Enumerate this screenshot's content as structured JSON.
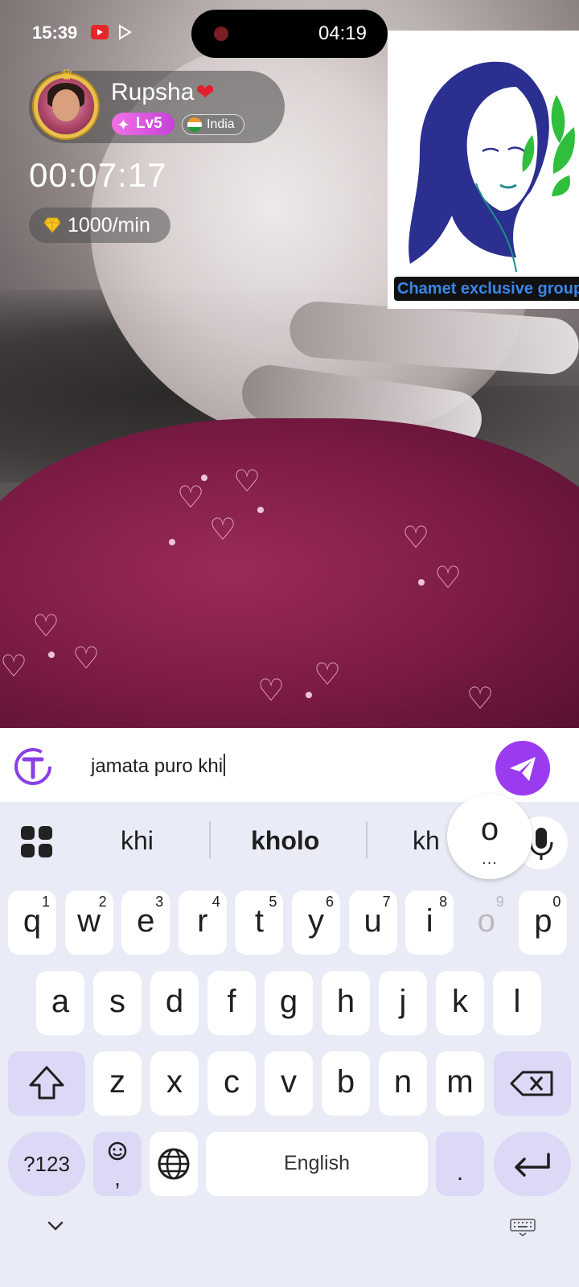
{
  "status_bar": {
    "time": "15:39",
    "recording_time": "04:19"
  },
  "host": {
    "name": "Rupsha",
    "level": "Lv5",
    "country": "India"
  },
  "call": {
    "timer": "00:07:17",
    "rate": "1000/min"
  },
  "promo": {
    "caption": "Chamet exclusive group"
  },
  "composer": {
    "text": "jamata puro khi"
  },
  "keyboard": {
    "suggestions": [
      "khi",
      "kholo",
      "kh"
    ],
    "popup_char": "o",
    "popup_dots": "...",
    "row1": [
      {
        "ch": "q",
        "hint": "1"
      },
      {
        "ch": "w",
        "hint": "2"
      },
      {
        "ch": "e",
        "hint": "3"
      },
      {
        "ch": "r",
        "hint": "4"
      },
      {
        "ch": "t",
        "hint": "5"
      },
      {
        "ch": "y",
        "hint": "6"
      },
      {
        "ch": "u",
        "hint": "7"
      },
      {
        "ch": "i",
        "hint": "8"
      },
      {
        "ch": "o",
        "hint": "9"
      },
      {
        "ch": "p",
        "hint": "0"
      }
    ],
    "row2": [
      "a",
      "s",
      "d",
      "f",
      "g",
      "h",
      "j",
      "k",
      "l"
    ],
    "row3": [
      "z",
      "x",
      "c",
      "v",
      "b",
      "n",
      "m"
    ],
    "symbols_label": "?123",
    "comma_label": ",",
    "space_label": "English",
    "period_label": "."
  }
}
